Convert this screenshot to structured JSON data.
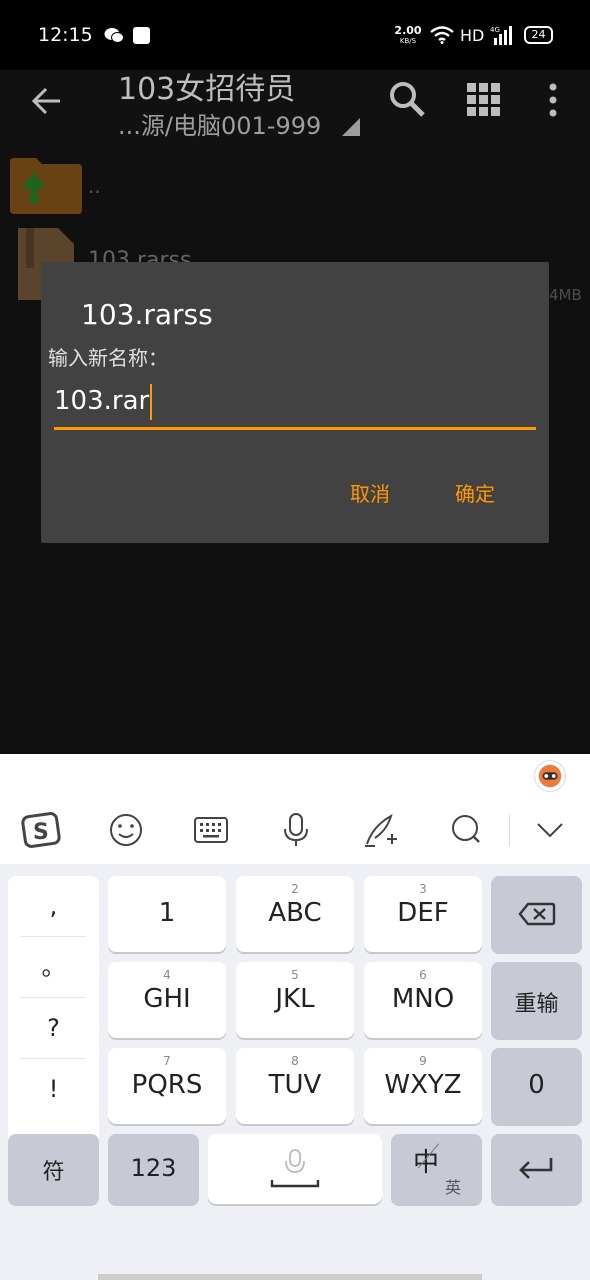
{
  "status_bar": {
    "time": "12:15",
    "speed_value": "2.00",
    "speed_unit": "KB/S",
    "network": "HD",
    "signal": "4G",
    "battery": "24"
  },
  "app_bar": {
    "title": "103女招待员",
    "subtitle": "...源/电脑001-999"
  },
  "file_list": {
    "up_label": "..",
    "file_name": "103.rarss",
    "file_size": "4MB"
  },
  "dialog": {
    "title": "103.rarss",
    "label": "输入新名称：",
    "input_value": "103.rar",
    "cancel_label": "取消",
    "ok_label": "确定",
    "accent": "#ff9800"
  },
  "keyboard": {
    "punctuation": [
      ",",
      "。",
      "?",
      "!"
    ],
    "rows": [
      [
        {
          "num": "",
          "label": "1"
        },
        {
          "num": "2",
          "label": "ABC"
        },
        {
          "num": "3",
          "label": "DEF"
        }
      ],
      [
        {
          "num": "4",
          "label": "GHI"
        },
        {
          "num": "5",
          "label": "JKL"
        },
        {
          "num": "6",
          "label": "MNO"
        }
      ],
      [
        {
          "num": "7",
          "label": "PQRS"
        },
        {
          "num": "8",
          "label": "TUV"
        },
        {
          "num": "9",
          "label": "WXYZ"
        }
      ]
    ],
    "reenter_label": "重输",
    "zero_label": "0",
    "symbol_label": "符",
    "num_label": "123",
    "lang_main": "中",
    "lang_sub": "英"
  }
}
